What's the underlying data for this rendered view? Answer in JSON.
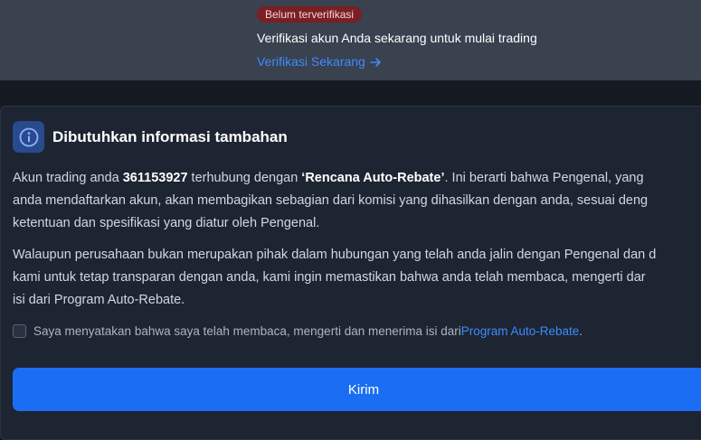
{
  "verification": {
    "badge": "Belum terverifikasi",
    "title": "Verifikasi akun Anda sekarang untuk mulai trading",
    "link": "Verifikasi Sekarang"
  },
  "dialog": {
    "title": "Dibutuhkan informasi tambahan",
    "paragraph1": {
      "line1_a": "Akun trading anda ",
      "account_number": "361153927",
      "line1_b": " terhubung dengan ",
      "plan_name": "‘Rencana Auto-Rebate’",
      "line1_c": ". Ini berarti bahwa Pengenal, yang",
      "line2": "anda mendaftarkan akun, akan membagikan sebagian dari komisi yang dihasilkan dengan anda, sesuai deng",
      "line3": "ketentuan dan spesifikasi yang diatur oleh Pengenal."
    },
    "paragraph2": {
      "line1": "Walaupun perusahaan bukan merupakan pihak dalam hubungan yang telah anda jalin dengan Pengenal dan d",
      "line2": "kami untuk tetap transparan dengan anda, kami ingin memastikan bahwa anda telah membaca, mengerti dar",
      "line3": "isi dari Program Auto-Rebate."
    },
    "consent": {
      "text": "Saya menyatakan bahwa saya telah membaca, mengerti dan menerima isi dari ",
      "link": "Program Auto-Rebate",
      "suffix": "."
    },
    "submit_label": "Kirim"
  }
}
